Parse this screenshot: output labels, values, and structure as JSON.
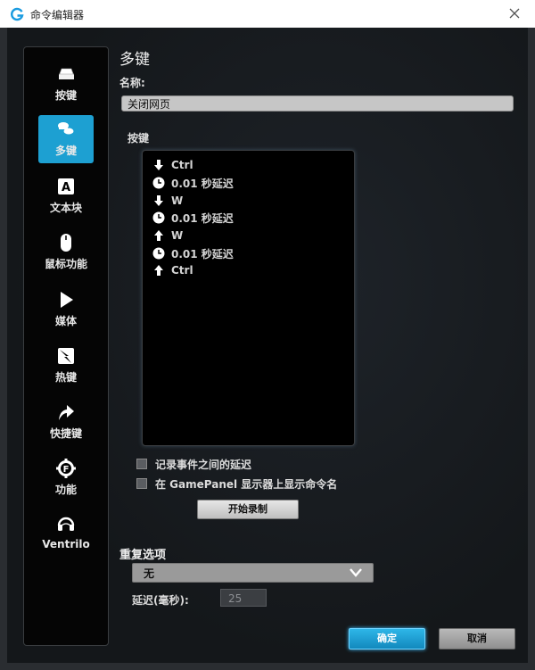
{
  "window": {
    "title": "命令编辑器"
  },
  "sidebar": {
    "items": [
      {
        "label": "按键",
        "icon": "keycap-icon"
      },
      {
        "label": "多键",
        "icon": "multikey-icon",
        "active": true
      },
      {
        "label": "文本块",
        "icon": "text-block-icon",
        "glyph": "A"
      },
      {
        "label": "鼠标功能",
        "icon": "mouse-icon"
      },
      {
        "label": "媒体",
        "icon": "play-icon"
      },
      {
        "label": "热键",
        "icon": "hotkey-icon"
      },
      {
        "label": "快捷键",
        "icon": "shortcut-arrow-icon"
      },
      {
        "label": "功能",
        "icon": "gear-f-icon",
        "glyph": "F"
      },
      {
        "label": "Ventrilo",
        "icon": "headset-icon"
      }
    ]
  },
  "main": {
    "heading": "多键",
    "name_label": "名称:",
    "name_value": "关闭网页",
    "keys_label": "按键",
    "keys": [
      {
        "type": "down",
        "text": "Ctrl"
      },
      {
        "type": "delay",
        "text": "0.01 秒延迟"
      },
      {
        "type": "down",
        "text": "W"
      },
      {
        "type": "delay",
        "text": "0.01 秒延迟"
      },
      {
        "type": "up",
        "text": "W"
      },
      {
        "type": "delay",
        "text": "0.01 秒延迟"
      },
      {
        "type": "up",
        "text": "Ctrl"
      }
    ],
    "record_delay_label": "记录事件之间的延迟",
    "show_name_label": "在 GamePanel 显示器上显示命令名",
    "record_button": "开始录制",
    "repeat_label": "重复选项",
    "repeat_value": "无",
    "delay_label": "延迟(毫秒):",
    "delay_value": "25"
  },
  "buttons": {
    "ok": "确定",
    "cancel": "取消"
  },
  "colors": {
    "accent": "#1da0d2",
    "background": "#171a1e"
  }
}
